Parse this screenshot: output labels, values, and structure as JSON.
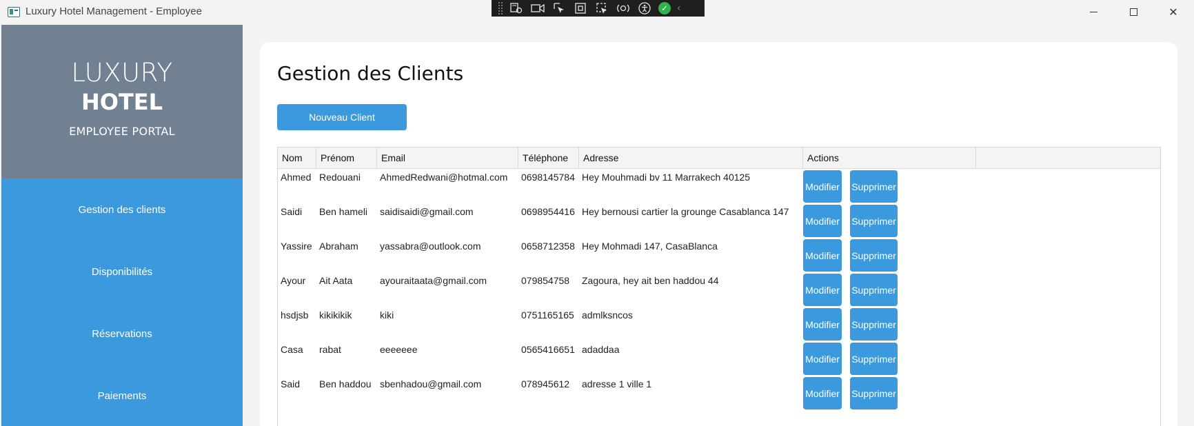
{
  "window": {
    "title": "Luxury Hotel Management - Employee",
    "controls": {
      "minimize": "–",
      "maximize": "□",
      "close": "✕"
    }
  },
  "debug_toolbar": {
    "icons": [
      "live-visual-tree-icon",
      "record-icon",
      "select-element-icon",
      "display-layout-adorners-icon",
      "track-focus-icon",
      "binding-failures-icon",
      "accessibility-icon",
      "hot-reload-status-icon",
      "collapse-chevron-icon"
    ]
  },
  "brand": {
    "line1": "LUXURY",
    "line2": "HOTEL",
    "line3": "EMPLOYEE PORTAL"
  },
  "sidebar": {
    "items": [
      {
        "label": "Gestion des clients"
      },
      {
        "label": "Disponibilités"
      },
      {
        "label": "Réservations"
      },
      {
        "label": "Paiements"
      }
    ]
  },
  "main": {
    "title": "Gestion des Clients",
    "new_button": "Nouveau Client"
  },
  "table": {
    "columns": [
      "Nom",
      "Prénom",
      "Email",
      "Téléphone",
      "Adresse",
      "Actions"
    ],
    "edit_label": "Modifier",
    "delete_label": "Supprimer",
    "rows": [
      {
        "nom": "Ahmed",
        "prenom": "Redouani",
        "email": "AhmedRedwani@hotmal.com",
        "tel": "0698145784",
        "adresse": "Hey Mouhmadi bv 11 Marrakech 40125"
      },
      {
        "nom": "Saidi",
        "prenom": "Ben hameli",
        "email": "saidisaidi@gmail.com",
        "tel": "0698954416",
        "adresse": "Hey bernousi cartier la grounge Casablanca 147"
      },
      {
        "nom": "Yassire",
        "prenom": "Abraham",
        "email": "yassabra@outlook.com",
        "tel": "0658712358",
        "adresse": "Hey Mohmadi 147, CasaBlanca"
      },
      {
        "nom": "Ayour",
        "prenom": "Ait Aata",
        "email": "ayouraitaata@gmail.com",
        "tel": "079854758",
        "adresse": "Zagoura, hey ait ben haddou 44"
      },
      {
        "nom": "hsdjsb",
        "prenom": "kikikikik",
        "email": "kiki",
        "tel": "0751165165",
        "adresse": "admlksncos"
      },
      {
        "nom": "Casa",
        "prenom": "rabat",
        "email": "eeeeeee",
        "tel": "0565416651",
        "adresse": "adaddaa"
      },
      {
        "nom": "Said",
        "prenom": "Ben haddou",
        "email": "sbenhadou@gmail.com",
        "tel": "078945612",
        "adresse": "adresse 1 ville 1"
      }
    ]
  },
  "colors": {
    "accent": "#3b99dd",
    "brand_panel": "#718191"
  }
}
